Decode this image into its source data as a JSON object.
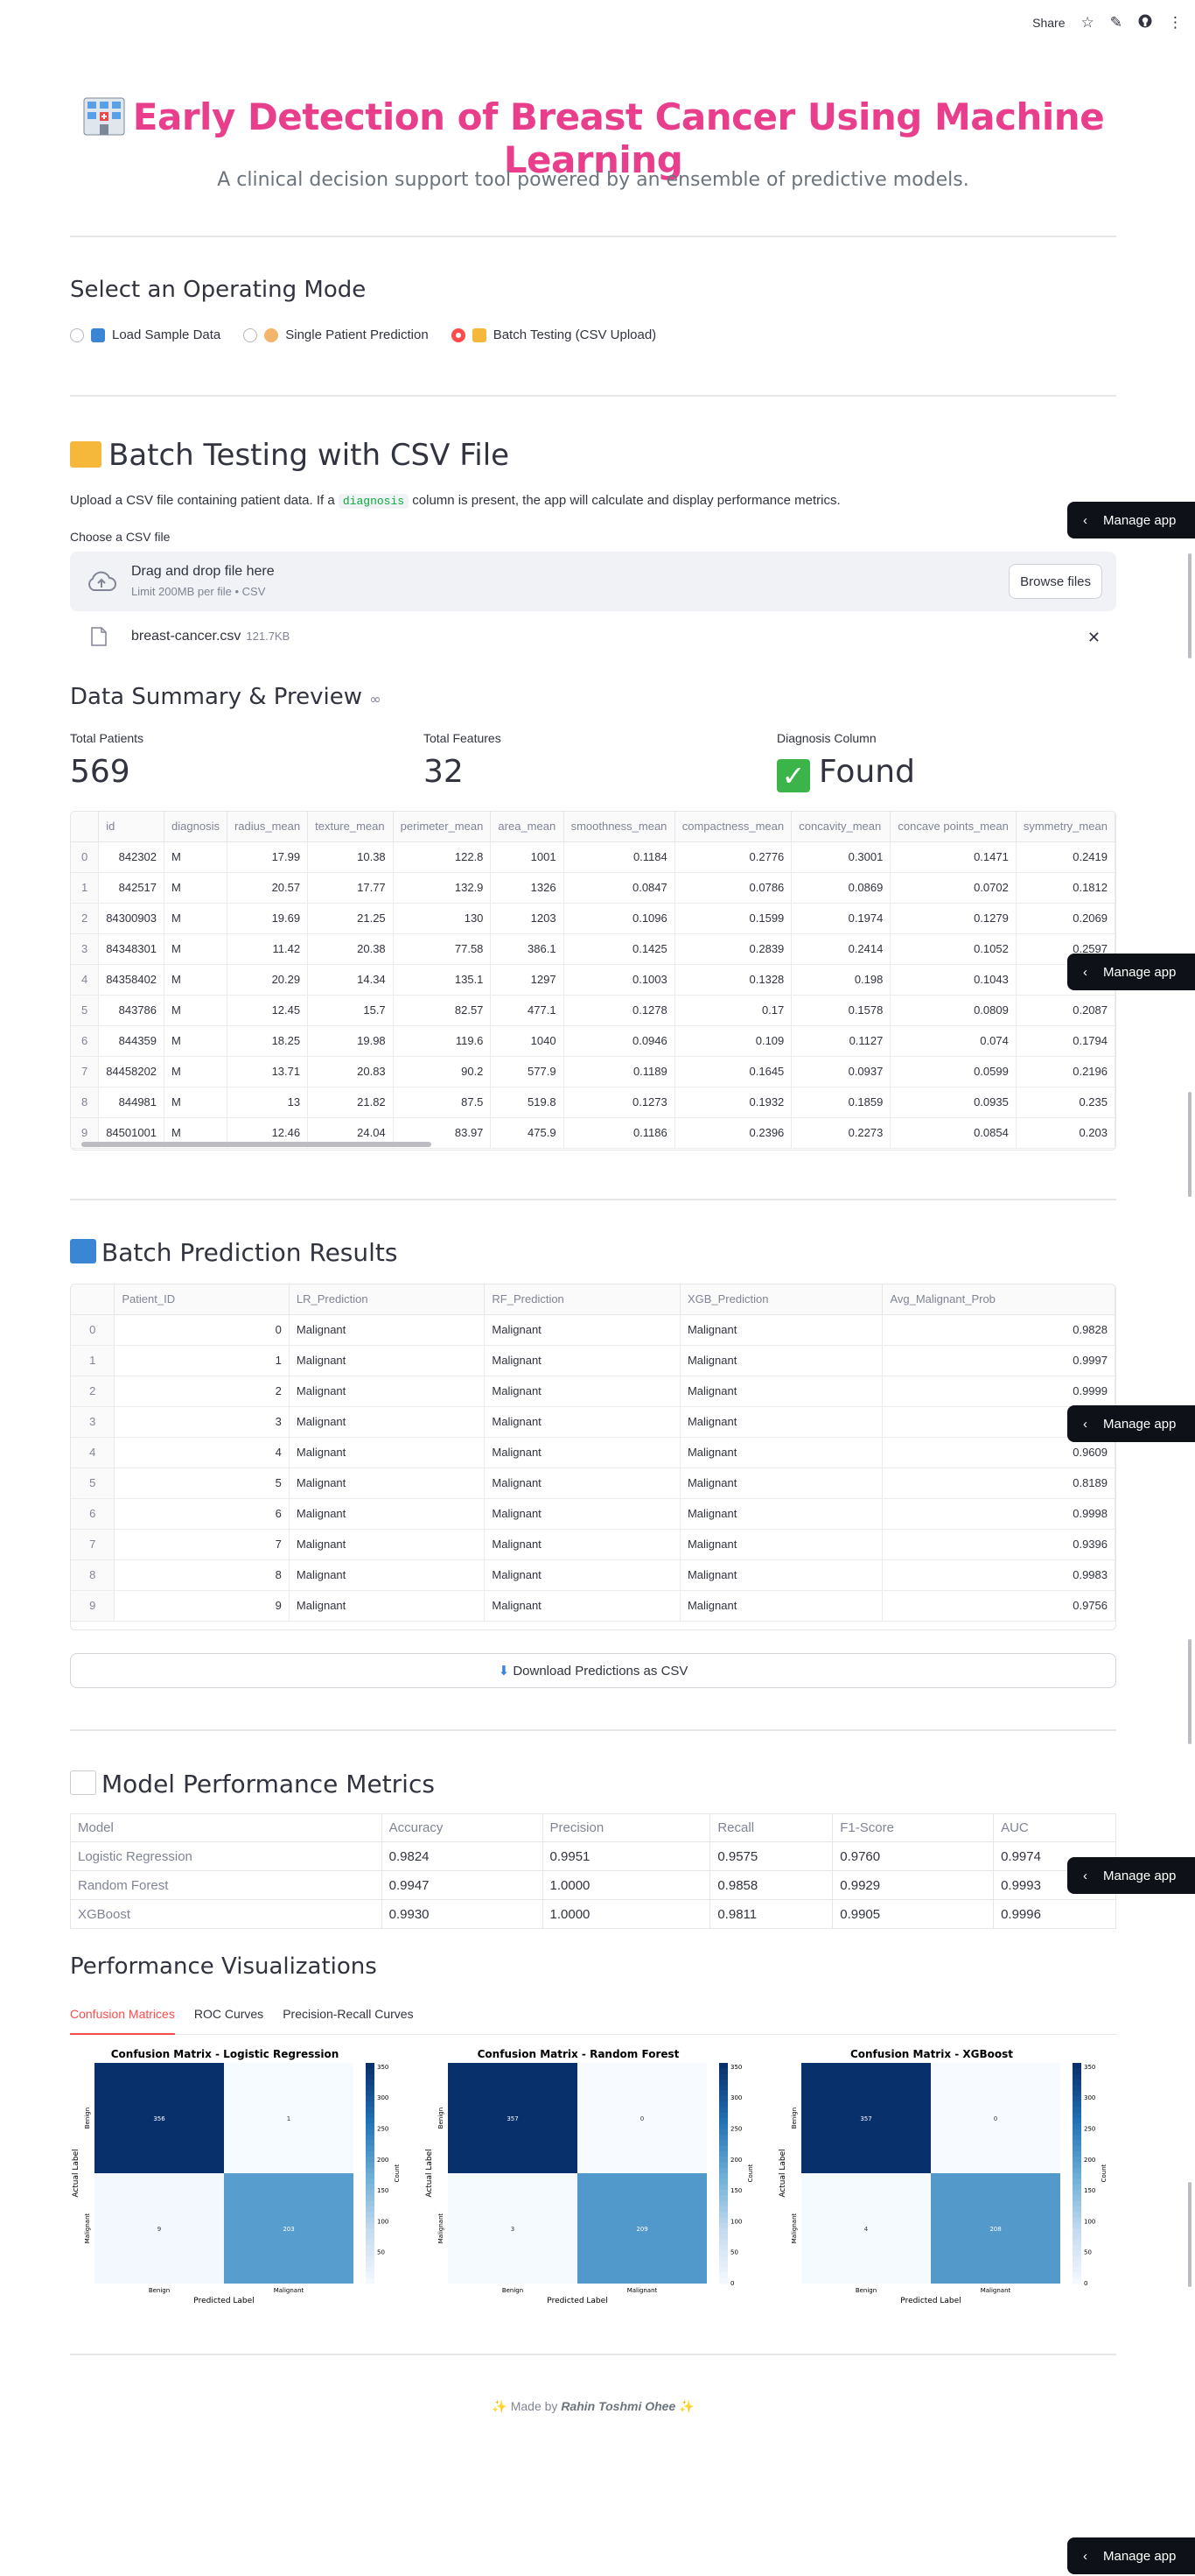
{
  "toolbar": {
    "share_label": "Share"
  },
  "header": {
    "title": "Early Detection of Breast Cancer Using Machine Learning",
    "subtitle": "A clinical decision support tool powered by an ensemble of predictive models."
  },
  "mode": {
    "heading": "Select an Operating Mode",
    "options": [
      "Load Sample Data",
      "Single Patient Prediction",
      "Batch Testing (CSV Upload)"
    ],
    "selected": "Batch Testing (CSV Upload)"
  },
  "batch": {
    "heading": "Batch Testing with CSV File",
    "desc_before": "Upload a CSV file containing patient data. If a",
    "desc_code": "diagnosis",
    "desc_after": "column is present, the app will calculate and display performance metrics.",
    "uploader_label": "Choose a CSV file",
    "drag_text": "Drag and drop file here",
    "limit_text": "Limit 200MB per file • CSV",
    "browse_label": "Browse files",
    "file_name": "breast-cancer.csv",
    "file_size": "121.7KB"
  },
  "summary": {
    "heading": "Data Summary & Preview",
    "metrics": [
      {
        "label": "Total Patients",
        "value": "569"
      },
      {
        "label": "Total Features",
        "value": "32"
      },
      {
        "label": "Diagnosis Column",
        "value": "Found"
      }
    ],
    "preview_columns": [
      "",
      "id",
      "diagnosis",
      "radius_mean",
      "texture_mean",
      "perimeter_mean",
      "area_mean",
      "smoothness_mean",
      "compactness_mean",
      "concavity_mean",
      "concave points_mean",
      "symmetry_mean"
    ],
    "preview_rows": [
      [
        "0",
        "842302",
        "M",
        "17.99",
        "10.38",
        "122.8",
        "1001",
        "0.1184",
        "0.2776",
        "0.3001",
        "0.1471",
        "0.2419"
      ],
      [
        "1",
        "842517",
        "M",
        "20.57",
        "17.77",
        "132.9",
        "1326",
        "0.0847",
        "0.0786",
        "0.0869",
        "0.0702",
        "0.1812"
      ],
      [
        "2",
        "84300903",
        "M",
        "19.69",
        "21.25",
        "130",
        "1203",
        "0.1096",
        "0.1599",
        "0.1974",
        "0.1279",
        "0.2069"
      ],
      [
        "3",
        "84348301",
        "M",
        "11.42",
        "20.38",
        "77.58",
        "386.1",
        "0.1425",
        "0.2839",
        "0.2414",
        "0.1052",
        "0.2597"
      ],
      [
        "4",
        "84358402",
        "M",
        "20.29",
        "14.34",
        "135.1",
        "1297",
        "0.1003",
        "0.1328",
        "0.198",
        "0.1043",
        "0.1809"
      ],
      [
        "5",
        "843786",
        "M",
        "12.45",
        "15.7",
        "82.57",
        "477.1",
        "0.1278",
        "0.17",
        "0.1578",
        "0.0809",
        "0.2087"
      ],
      [
        "6",
        "844359",
        "M",
        "18.25",
        "19.98",
        "119.6",
        "1040",
        "0.0946",
        "0.109",
        "0.1127",
        "0.074",
        "0.1794"
      ],
      [
        "7",
        "84458202",
        "M",
        "13.71",
        "20.83",
        "90.2",
        "577.9",
        "0.1189",
        "0.1645",
        "0.0937",
        "0.0599",
        "0.2196"
      ],
      [
        "8",
        "844981",
        "M",
        "13",
        "21.82",
        "87.5",
        "519.8",
        "0.1273",
        "0.1932",
        "0.1859",
        "0.0935",
        "0.235"
      ],
      [
        "9",
        "84501001",
        "M",
        "12.46",
        "24.04",
        "83.97",
        "475.9",
        "0.1186",
        "0.2396",
        "0.2273",
        "0.0854",
        "0.203"
      ]
    ]
  },
  "results": {
    "heading": "Batch Prediction Results",
    "columns": [
      "",
      "Patient_ID",
      "LR_Prediction",
      "RF_Prediction",
      "XGB_Prediction",
      "Avg_Malignant_Prob"
    ],
    "rows": [
      [
        "0",
        "0",
        "Malignant",
        "Malignant",
        "Malignant",
        "0.9828"
      ],
      [
        "1",
        "1",
        "Malignant",
        "Malignant",
        "Malignant",
        "0.9997"
      ],
      [
        "2",
        "2",
        "Malignant",
        "Malignant",
        "Malignant",
        "0.9999"
      ],
      [
        "3",
        "3",
        "Malignant",
        "Malignant",
        "Malignant",
        "0.9978"
      ],
      [
        "4",
        "4",
        "Malignant",
        "Malignant",
        "Malignant",
        "0.9609"
      ],
      [
        "5",
        "5",
        "Malignant",
        "Malignant",
        "Malignant",
        "0.8189"
      ],
      [
        "6",
        "6",
        "Malignant",
        "Malignant",
        "Malignant",
        "0.9998"
      ],
      [
        "7",
        "7",
        "Malignant",
        "Malignant",
        "Malignant",
        "0.9396"
      ],
      [
        "8",
        "8",
        "Malignant",
        "Malignant",
        "Malignant",
        "0.9983"
      ],
      [
        "9",
        "9",
        "Malignant",
        "Malignant",
        "Malignant",
        "0.9756"
      ]
    ],
    "download_label": "Download Predictions as CSV"
  },
  "performance": {
    "heading": "Model Performance Metrics",
    "columns": [
      "Model",
      "Accuracy",
      "Precision",
      "Recall",
      "F1-Score",
      "AUC"
    ],
    "rows": [
      [
        "Logistic Regression",
        "0.9824",
        "0.9951",
        "0.9575",
        "0.9760",
        "0.9974"
      ],
      [
        "Random Forest",
        "0.9947",
        "1.0000",
        "0.9858",
        "0.9929",
        "0.9993"
      ],
      [
        "XGBoost",
        "0.9930",
        "1.0000",
        "0.9811",
        "0.9905",
        "0.9996"
      ]
    ]
  },
  "viz": {
    "heading": "Performance Visualizations",
    "tabs": [
      "Confusion Matrices",
      "ROC Curves",
      "Precision-Recall Curves"
    ],
    "active_tab": "Confusion Matrices"
  },
  "chart_data": [
    {
      "type": "heatmap",
      "title": "Confusion Matrix - Logistic Regression",
      "xlabel": "Predicted Label",
      "ylabel": "Actual Label",
      "x_categories": [
        "Benign",
        "Malignant"
      ],
      "y_categories": [
        "Benign",
        "Malignant"
      ],
      "values": [
        [
          356,
          1
        ],
        [
          9,
          203
        ]
      ],
      "colorbar_label": "Count",
      "colorbar_ticks": [
        50,
        100,
        150,
        200,
        250,
        300,
        350
      ],
      "colormap": "Blues"
    },
    {
      "type": "heatmap",
      "title": "Confusion Matrix - Random Forest",
      "xlabel": "Predicted Label",
      "ylabel": "Actual Label",
      "x_categories": [
        "Benign",
        "Malignant"
      ],
      "y_categories": [
        "Benign",
        "Malignant"
      ],
      "values": [
        [
          357,
          0
        ],
        [
          3,
          209
        ]
      ],
      "colorbar_label": "Count",
      "colorbar_ticks": [
        0,
        50,
        100,
        150,
        200,
        250,
        300,
        350
      ],
      "colormap": "Blues"
    },
    {
      "type": "heatmap",
      "title": "Confusion Matrix - XGBoost",
      "xlabel": "Predicted Label",
      "ylabel": "Actual Label",
      "x_categories": [
        "Benign",
        "Malignant"
      ],
      "y_categories": [
        "Benign",
        "Malignant"
      ],
      "values": [
        [
          357,
          0
        ],
        [
          4,
          208
        ]
      ],
      "colorbar_label": "Count",
      "colorbar_ticks": [
        0,
        50,
        100,
        150,
        200,
        250,
        300,
        350
      ],
      "colormap": "Blues"
    }
  ],
  "footer": {
    "made_by": "Made by",
    "author": "Rahin Toshmi Ohee"
  },
  "manage_app": "Manage app",
  "colors": {
    "title": "#e83e8c",
    "accent": "#ff4b4b",
    "dark": "#0e1117"
  }
}
